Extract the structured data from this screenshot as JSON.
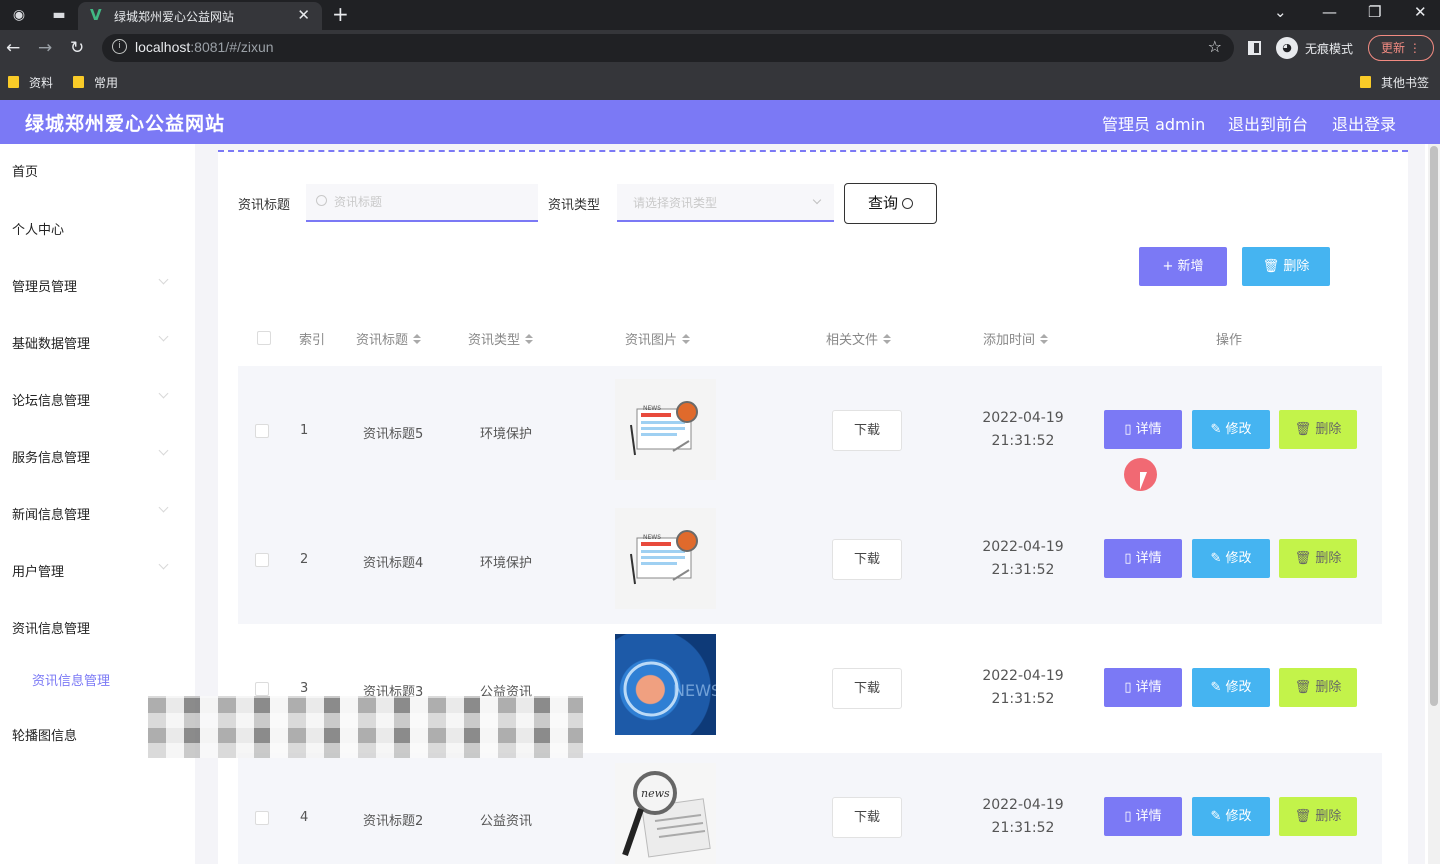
{
  "browser": {
    "tab_title": "绿城郑州爱心公益网站",
    "tab_favicon": "V",
    "url_host": "localhost",
    "url_rest": ":8081/#/zixun",
    "incognito_label": "无痕模式",
    "update_label": "更新",
    "bookmarks": [
      "资料",
      "常用"
    ],
    "other_bookmarks": "其他书签"
  },
  "header": {
    "brand": "绿城郑州爱心公益网站",
    "user": "管理员 admin",
    "back_front": "退出到前台",
    "logout": "退出登录"
  },
  "sidebar": {
    "items": [
      {
        "label": "首页"
      },
      {
        "label": "个人中心"
      },
      {
        "label": "管理员管理"
      },
      {
        "label": "基础数据管理"
      },
      {
        "label": "论坛信息管理"
      },
      {
        "label": "服务信息管理"
      },
      {
        "label": "新闻信息管理"
      },
      {
        "label": "用户管理"
      },
      {
        "label": "资讯信息管理"
      },
      {
        "label": "资讯信息管理"
      },
      {
        "label": "轮播图信息"
      }
    ]
  },
  "search": {
    "title_label": "资讯标题",
    "title_placeholder": "资讯标题",
    "type_label": "资讯类型",
    "type_placeholder": "请选择资讯类型",
    "query_label": "查询"
  },
  "toolbar": {
    "add_label": "+ 新增",
    "delete_label": "删除"
  },
  "table": {
    "columns": [
      "索引",
      "资讯标题",
      "资讯类型",
      "资讯图片",
      "相关文件",
      "添加时间",
      "操作"
    ],
    "download_label": "下载",
    "detail_label": "详情",
    "edit_label": "修改",
    "delete_label": "删除",
    "rows": [
      {
        "index": "1",
        "title": "资讯标题5",
        "type": "环境保护",
        "image": "news-icon-image",
        "date": "2022-04-19",
        "time": "21:31:52"
      },
      {
        "index": "2",
        "title": "资讯标题4",
        "type": "环境保护",
        "image": "news-icon-image",
        "date": "2022-04-19",
        "time": "21:31:52"
      },
      {
        "index": "3",
        "title": "资讯标题3",
        "type": "公益资讯",
        "image": "blue-news-image",
        "date": "2022-04-19",
        "time": "21:31:52"
      },
      {
        "index": "4",
        "title": "资讯标题2",
        "type": "公益资讯",
        "image": "magnifier-news-image",
        "date": "2022-04-19",
        "time": "21:31:52"
      }
    ]
  },
  "colors": {
    "accent": "#7b79f5",
    "edit": "#45b4f1",
    "delete": "#c3f34a"
  }
}
